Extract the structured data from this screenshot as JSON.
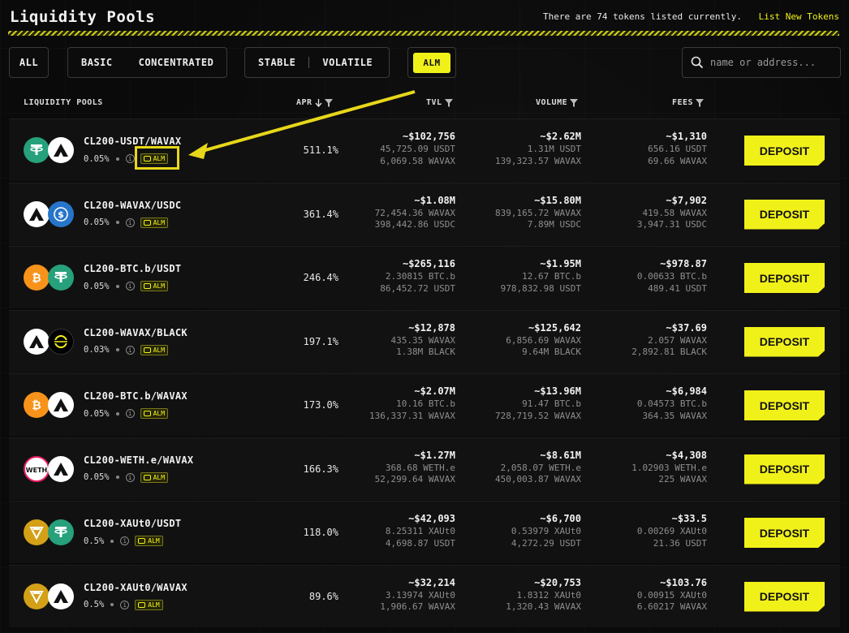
{
  "header": {
    "title": "Liquidity Pools",
    "note": "There are 74 tokens listed currently.",
    "link": "List New Tokens"
  },
  "filters": {
    "all": "ALL",
    "basic": "BASIC",
    "concentrated": "CONCENTRATED",
    "stable": "STABLE",
    "volatile": "VOLATILE",
    "alm": "ALM"
  },
  "search": {
    "placeholder": "name or address..."
  },
  "columns": {
    "pools": "LIQUIDITY POOLS",
    "apr": "APR",
    "tvl": "TVL",
    "volume": "VOLUME",
    "fees": "FEES"
  },
  "deposit_label": "DEPOSIT",
  "alm_badge": "ALM",
  "pools": [
    {
      "name": "CL200-USDT/WAVAX",
      "fee": "0.05%",
      "apr": "511.1%",
      "tvl": "~$102,756",
      "tvl_a": "45,725.09 USDT",
      "tvl_b": "6,069.58 WAVAX",
      "vol": "~$2.62M",
      "vol_a": "1.31M USDT",
      "vol_b": "139,323.57 WAVAX",
      "fees": "~$1,310",
      "fees_a": "656.16 USDT",
      "fees_b": "69.66 WAVAX",
      "token_a": "usdt-icon",
      "token_b": "avax-icon"
    },
    {
      "name": "CL200-WAVAX/USDC",
      "fee": "0.05%",
      "apr": "361.4%",
      "tvl": "~$1.08M",
      "tvl_a": "72,454.36 WAVAX",
      "tvl_b": "398,442.86 USDC",
      "vol": "~$15.80M",
      "vol_a": "839,165.72 WAVAX",
      "vol_b": "7.89M USDC",
      "fees": "~$7,902",
      "fees_a": "419.58 WAVAX",
      "fees_b": "3,947.31 USDC",
      "token_a": "avax-icon",
      "token_b": "usdc-icon"
    },
    {
      "name": "CL200-BTC.b/USDT",
      "fee": "0.05%",
      "apr": "246.4%",
      "tvl": "~$265,116",
      "tvl_a": "2.30815 BTC.b",
      "tvl_b": "86,452.72 USDT",
      "vol": "~$1.95M",
      "vol_a": "12.67 BTC.b",
      "vol_b": "978,832.98 USDT",
      "fees": "~$978.87",
      "fees_a": "0.00633 BTC.b",
      "fees_b": "489.41 USDT",
      "token_a": "btc-icon",
      "token_b": "usdt-icon"
    },
    {
      "name": "CL200-WAVAX/BLACK",
      "fee": "0.03%",
      "apr": "197.1%",
      "tvl": "~$12,878",
      "tvl_a": "435.35 WAVAX",
      "tvl_b": "1.38M BLACK",
      "vol": "~$125,642",
      "vol_a": "6,856.69 WAVAX",
      "vol_b": "9.64M BLACK",
      "fees": "~$37.69",
      "fees_a": "2.057 WAVAX",
      "fees_b": "2,892.81 BLACK",
      "token_a": "avax-icon",
      "token_b": "black-icon"
    },
    {
      "name": "CL200-BTC.b/WAVAX",
      "fee": "0.05%",
      "apr": "173.0%",
      "tvl": "~$2.07M",
      "tvl_a": "10.16 BTC.b",
      "tvl_b": "136,337.31 WAVAX",
      "vol": "~$13.96M",
      "vol_a": "91.47 BTC.b",
      "vol_b": "728,719.52 WAVAX",
      "fees": "~$6,984",
      "fees_a": "0.04573 BTC.b",
      "fees_b": "364.35 WAVAX",
      "token_a": "btc-icon",
      "token_b": "avax-icon"
    },
    {
      "name": "CL200-WETH.e/WAVAX",
      "fee": "0.05%",
      "apr": "166.3%",
      "tvl": "~$1.27M",
      "tvl_a": "368.68 WETH.e",
      "tvl_b": "52,299.64 WAVAX",
      "vol": "~$8.61M",
      "vol_a": "2,058.07 WETH.e",
      "vol_b": "450,003.87 WAVAX",
      "fees": "~$4,308",
      "fees_a": "1.02903 WETH.e",
      "fees_b": "225 WAVAX",
      "token_a": "weth-icon",
      "token_b": "avax-icon"
    },
    {
      "name": "CL200-XAUt0/USDT",
      "fee": "0.5%",
      "apr": "118.0%",
      "tvl": "~$42,093",
      "tvl_a": "8.25311 XAUt0",
      "tvl_b": "4,698.87 USDT",
      "vol": "~$6,700",
      "vol_a": "0.53979 XAUt0",
      "vol_b": "4,272.29 USDT",
      "fees": "~$33.5",
      "fees_a": "0.00269 XAUt0",
      "fees_b": "21.36 USDT",
      "token_a": "xaut-icon",
      "token_b": "usdt-icon"
    },
    {
      "name": "CL200-XAUt0/WAVAX",
      "fee": "0.5%",
      "apr": "89.6%",
      "tvl": "~$32,214",
      "tvl_a": "3.13974 XAUt0",
      "tvl_b": "1,906.67 WAVAX",
      "vol": "~$20,753",
      "vol_a": "1.8312 XAUt0",
      "vol_b": "1,320.43 WAVAX",
      "fees": "~$103.76",
      "fees_a": "0.00915 XAUt0",
      "fees_b": "6.60217 WAVAX",
      "token_a": "xaut-icon",
      "token_b": "avax-icon"
    }
  ],
  "colors": {
    "accent": "#f1f11a",
    "background": "#0a0a0a",
    "row": "#111111",
    "muted": "#8e8e8e"
  }
}
